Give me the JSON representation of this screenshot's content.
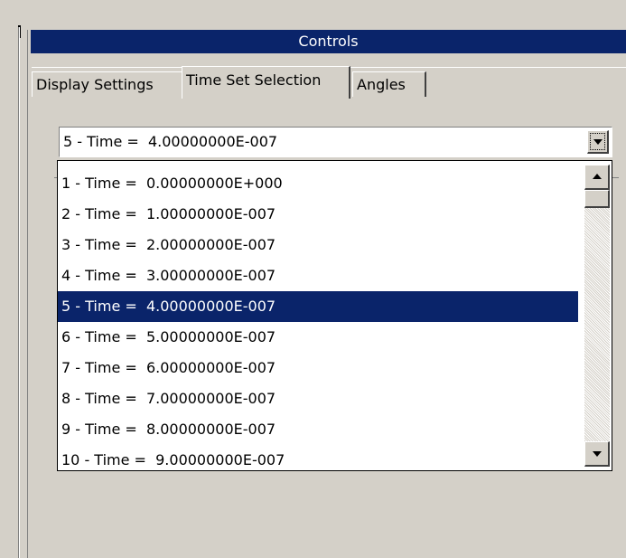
{
  "panel": {
    "title": "Controls"
  },
  "tabs": [
    {
      "label": "Display Settings",
      "active": false
    },
    {
      "label": "Time Set Selection",
      "active": true
    },
    {
      "label": "Angles",
      "active": false
    }
  ],
  "combo": {
    "selected_value": "5 - Time =  4.00000000E-007",
    "button_icon": "chevron-down-icon"
  },
  "dropdown": {
    "items": [
      "1 - Time =  0.00000000E+000",
      "2 - Time =  1.00000000E-007",
      "3 - Time =  2.00000000E-007",
      "4 - Time =  3.00000000E-007",
      "5 - Time =  4.00000000E-007",
      "6 - Time =  5.00000000E-007",
      "7 - Time =  6.00000000E-007",
      "8 - Time =  7.00000000E-007",
      "9 - Time =  8.00000000E-007",
      "10 - Time =  9.00000000E-007"
    ],
    "selected_index": 4
  },
  "colors": {
    "selection": "#0a246a",
    "title_bar": "#0a246a",
    "face": "#d4d0c8"
  }
}
